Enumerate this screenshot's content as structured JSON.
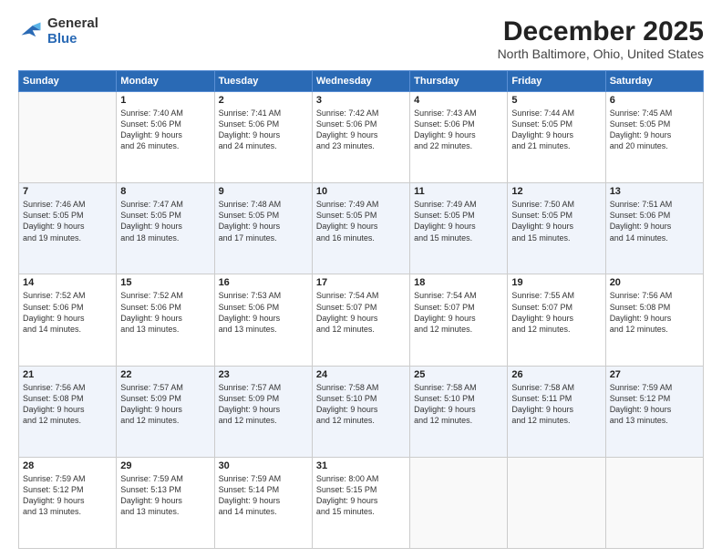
{
  "header": {
    "logo_general": "General",
    "logo_blue": "Blue",
    "title": "December 2025",
    "subtitle": "North Baltimore, Ohio, United States"
  },
  "weekdays": [
    "Sunday",
    "Monday",
    "Tuesday",
    "Wednesday",
    "Thursday",
    "Friday",
    "Saturday"
  ],
  "weeks": [
    [
      {
        "day": "",
        "info": ""
      },
      {
        "day": "1",
        "info": "Sunrise: 7:40 AM\nSunset: 5:06 PM\nDaylight: 9 hours\nand 26 minutes."
      },
      {
        "day": "2",
        "info": "Sunrise: 7:41 AM\nSunset: 5:06 PM\nDaylight: 9 hours\nand 24 minutes."
      },
      {
        "day": "3",
        "info": "Sunrise: 7:42 AM\nSunset: 5:06 PM\nDaylight: 9 hours\nand 23 minutes."
      },
      {
        "day": "4",
        "info": "Sunrise: 7:43 AM\nSunset: 5:06 PM\nDaylight: 9 hours\nand 22 minutes."
      },
      {
        "day": "5",
        "info": "Sunrise: 7:44 AM\nSunset: 5:05 PM\nDaylight: 9 hours\nand 21 minutes."
      },
      {
        "day": "6",
        "info": "Sunrise: 7:45 AM\nSunset: 5:05 PM\nDaylight: 9 hours\nand 20 minutes."
      }
    ],
    [
      {
        "day": "7",
        "info": "Sunrise: 7:46 AM\nSunset: 5:05 PM\nDaylight: 9 hours\nand 19 minutes."
      },
      {
        "day": "8",
        "info": "Sunrise: 7:47 AM\nSunset: 5:05 PM\nDaylight: 9 hours\nand 18 minutes."
      },
      {
        "day": "9",
        "info": "Sunrise: 7:48 AM\nSunset: 5:05 PM\nDaylight: 9 hours\nand 17 minutes."
      },
      {
        "day": "10",
        "info": "Sunrise: 7:49 AM\nSunset: 5:05 PM\nDaylight: 9 hours\nand 16 minutes."
      },
      {
        "day": "11",
        "info": "Sunrise: 7:49 AM\nSunset: 5:05 PM\nDaylight: 9 hours\nand 15 minutes."
      },
      {
        "day": "12",
        "info": "Sunrise: 7:50 AM\nSunset: 5:05 PM\nDaylight: 9 hours\nand 15 minutes."
      },
      {
        "day": "13",
        "info": "Sunrise: 7:51 AM\nSunset: 5:06 PM\nDaylight: 9 hours\nand 14 minutes."
      }
    ],
    [
      {
        "day": "14",
        "info": "Sunrise: 7:52 AM\nSunset: 5:06 PM\nDaylight: 9 hours\nand 14 minutes."
      },
      {
        "day": "15",
        "info": "Sunrise: 7:52 AM\nSunset: 5:06 PM\nDaylight: 9 hours\nand 13 minutes."
      },
      {
        "day": "16",
        "info": "Sunrise: 7:53 AM\nSunset: 5:06 PM\nDaylight: 9 hours\nand 13 minutes."
      },
      {
        "day": "17",
        "info": "Sunrise: 7:54 AM\nSunset: 5:07 PM\nDaylight: 9 hours\nand 12 minutes."
      },
      {
        "day": "18",
        "info": "Sunrise: 7:54 AM\nSunset: 5:07 PM\nDaylight: 9 hours\nand 12 minutes."
      },
      {
        "day": "19",
        "info": "Sunrise: 7:55 AM\nSunset: 5:07 PM\nDaylight: 9 hours\nand 12 minutes."
      },
      {
        "day": "20",
        "info": "Sunrise: 7:56 AM\nSunset: 5:08 PM\nDaylight: 9 hours\nand 12 minutes."
      }
    ],
    [
      {
        "day": "21",
        "info": "Sunrise: 7:56 AM\nSunset: 5:08 PM\nDaylight: 9 hours\nand 12 minutes."
      },
      {
        "day": "22",
        "info": "Sunrise: 7:57 AM\nSunset: 5:09 PM\nDaylight: 9 hours\nand 12 minutes."
      },
      {
        "day": "23",
        "info": "Sunrise: 7:57 AM\nSunset: 5:09 PM\nDaylight: 9 hours\nand 12 minutes."
      },
      {
        "day": "24",
        "info": "Sunrise: 7:58 AM\nSunset: 5:10 PM\nDaylight: 9 hours\nand 12 minutes."
      },
      {
        "day": "25",
        "info": "Sunrise: 7:58 AM\nSunset: 5:10 PM\nDaylight: 9 hours\nand 12 minutes."
      },
      {
        "day": "26",
        "info": "Sunrise: 7:58 AM\nSunset: 5:11 PM\nDaylight: 9 hours\nand 12 minutes."
      },
      {
        "day": "27",
        "info": "Sunrise: 7:59 AM\nSunset: 5:12 PM\nDaylight: 9 hours\nand 13 minutes."
      }
    ],
    [
      {
        "day": "28",
        "info": "Sunrise: 7:59 AM\nSunset: 5:12 PM\nDaylight: 9 hours\nand 13 minutes."
      },
      {
        "day": "29",
        "info": "Sunrise: 7:59 AM\nSunset: 5:13 PM\nDaylight: 9 hours\nand 13 minutes."
      },
      {
        "day": "30",
        "info": "Sunrise: 7:59 AM\nSunset: 5:14 PM\nDaylight: 9 hours\nand 14 minutes."
      },
      {
        "day": "31",
        "info": "Sunrise: 8:00 AM\nSunset: 5:15 PM\nDaylight: 9 hours\nand 15 minutes."
      },
      {
        "day": "",
        "info": ""
      },
      {
        "day": "",
        "info": ""
      },
      {
        "day": "",
        "info": ""
      }
    ]
  ]
}
